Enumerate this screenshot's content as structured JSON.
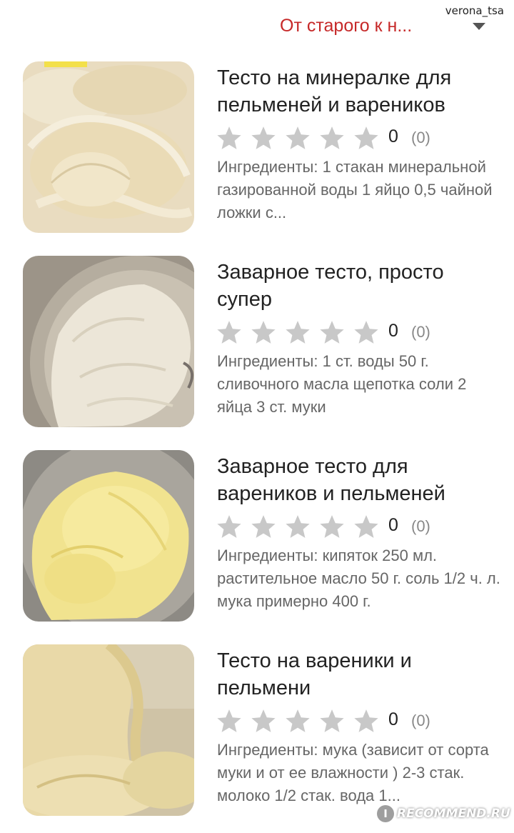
{
  "watermark": {
    "username": "verona_tsa",
    "site": "RECOMMEND.RU",
    "site_icon_letter": "I"
  },
  "sort": {
    "label": "От старого к н..."
  },
  "recipes": [
    {
      "title": "Тесто на минералке для пельменей и вареников",
      "rating_value": "0",
      "rating_count": "(0)",
      "ingredients": "Ингредиенты: 1 стакан минеральной газированной воды 1 яйцо 0,5 чайной ложки с..."
    },
    {
      "title": "Заварное тесто, просто супер",
      "rating_value": "0",
      "rating_count": "(0)",
      "ingredients": "Ингредиенты: 1 ст. воды 50 г. сливочного масла щепотка соли 2 яйца 3 ст. муки"
    },
    {
      "title": "Заварное тесто для вареников и пельменей",
      "rating_value": "0",
      "rating_count": "(0)",
      "ingredients": "Ингредиенты: кипяток 250 мл. растительное масло 50 г. соль 1/2 ч. л. мука примерно 400 г."
    },
    {
      "title": "Тесто на вареники и пельмени",
      "rating_value": "0",
      "rating_count": "(0)",
      "ingredients": "Ингредиенты: мука (зависит от сорта муки и от ее влажности ) 2-3 стак. молоко 1/2 стак. вода 1..."
    }
  ],
  "rating_max": 5,
  "colors": {
    "sort_text": "#c62828",
    "star_empty": "#c8c8c8",
    "ingredients_text": "#666666",
    "rating_count_text": "#888888"
  },
  "icons": {
    "sort": "triangle-down-icon",
    "star": "star-outline-icon"
  }
}
